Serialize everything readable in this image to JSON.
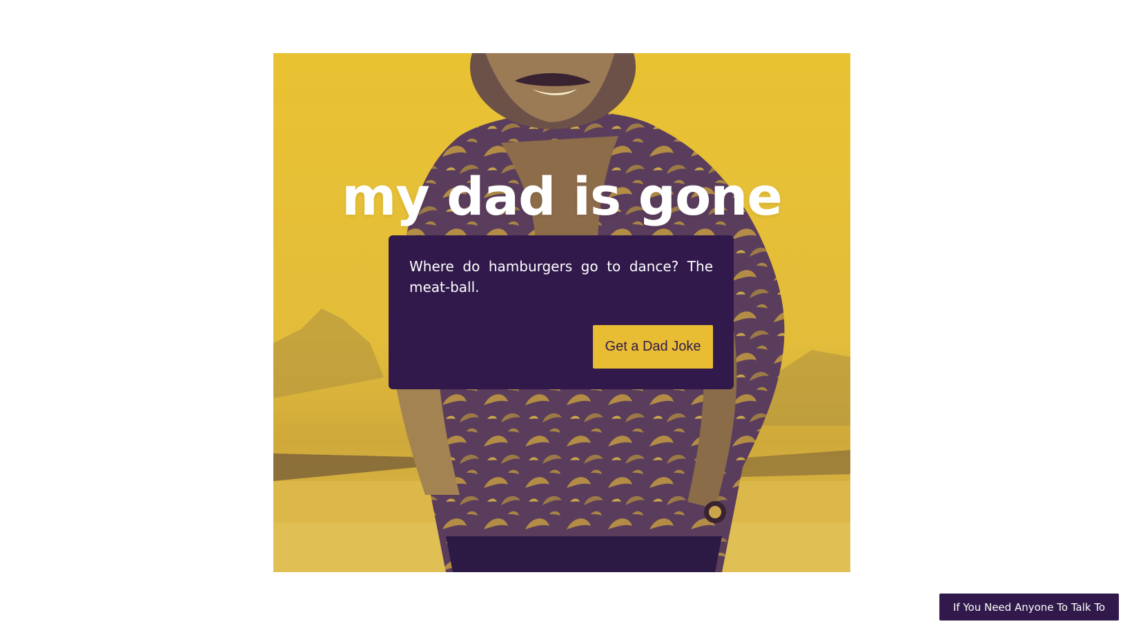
{
  "hero": {
    "title": "my dad is gone",
    "image": "man-in-hawaiian-shirt-duotone-photo"
  },
  "joke": {
    "text": "Where do hamburgers go to dance? The meat-ball.",
    "button_label": "Get a Dad Joke"
  },
  "footer": {
    "help_link_label": "If You Need Anyone To Talk To"
  },
  "colors": {
    "accent_yellow": "#e8bd33",
    "deep_purple": "#311a4b",
    "background": "#ffffff",
    "title_text": "#ffffff"
  }
}
